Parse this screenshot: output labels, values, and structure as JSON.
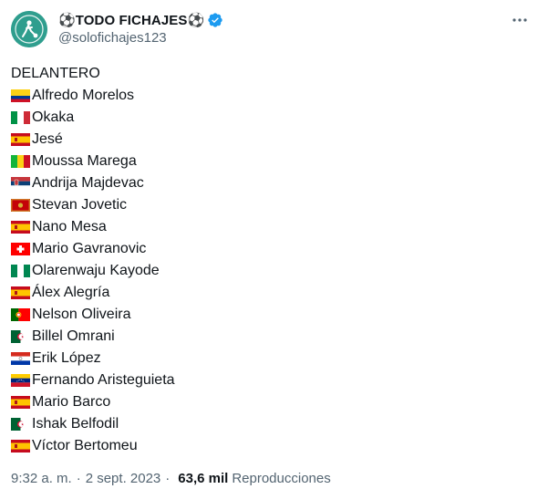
{
  "author": {
    "display_name": "⚽TODO FICHAJES⚽",
    "handle": "@solofichajes123",
    "avatar_text": "TODO FICHAJES",
    "verified_icon": "verified-badge-icon"
  },
  "more_icon": "more-icon",
  "tweet": {
    "heading": "DELANTERO",
    "players": [
      {
        "flag": "colombia",
        "name": "Alfredo Morelos"
      },
      {
        "flag": "italy",
        "name": "Okaka"
      },
      {
        "flag": "spain",
        "name": "Jesé"
      },
      {
        "flag": "mali",
        "name": "Moussa Marega"
      },
      {
        "flag": "serbia",
        "name": "Andrija Majdevac"
      },
      {
        "flag": "montenegro",
        "name": "Stevan Jovetic"
      },
      {
        "flag": "spain",
        "name": "Nano Mesa"
      },
      {
        "flag": "switzerland",
        "name": "Mario Gavranovic"
      },
      {
        "flag": "nigeria",
        "name": "Olarenwaju Kayode"
      },
      {
        "flag": "spain",
        "name": "Álex Alegría"
      },
      {
        "flag": "portugal",
        "name": "Nelson Oliveira"
      },
      {
        "flag": "algeria",
        "name": "Billel Omrani"
      },
      {
        "flag": "paraguay",
        "name": "Erik López"
      },
      {
        "flag": "venezuela",
        "name": "Fernando Aristeguieta"
      },
      {
        "flag": "spain",
        "name": "Mario Barco"
      },
      {
        "flag": "algeria",
        "name": "Ishak Belfodil"
      },
      {
        "flag": "spain",
        "name": "Víctor Bertomeu"
      }
    ]
  },
  "footer": {
    "time": "9:32 a. m.",
    "separator": "·",
    "date": "2 sept. 2023",
    "views": "63,6 mil",
    "views_label": "Reproducciones"
  },
  "colors": {
    "text": "#0f1419",
    "secondary": "#536471",
    "verified": "#1d9bf0",
    "avatar_bg": "#2f9e8e"
  }
}
